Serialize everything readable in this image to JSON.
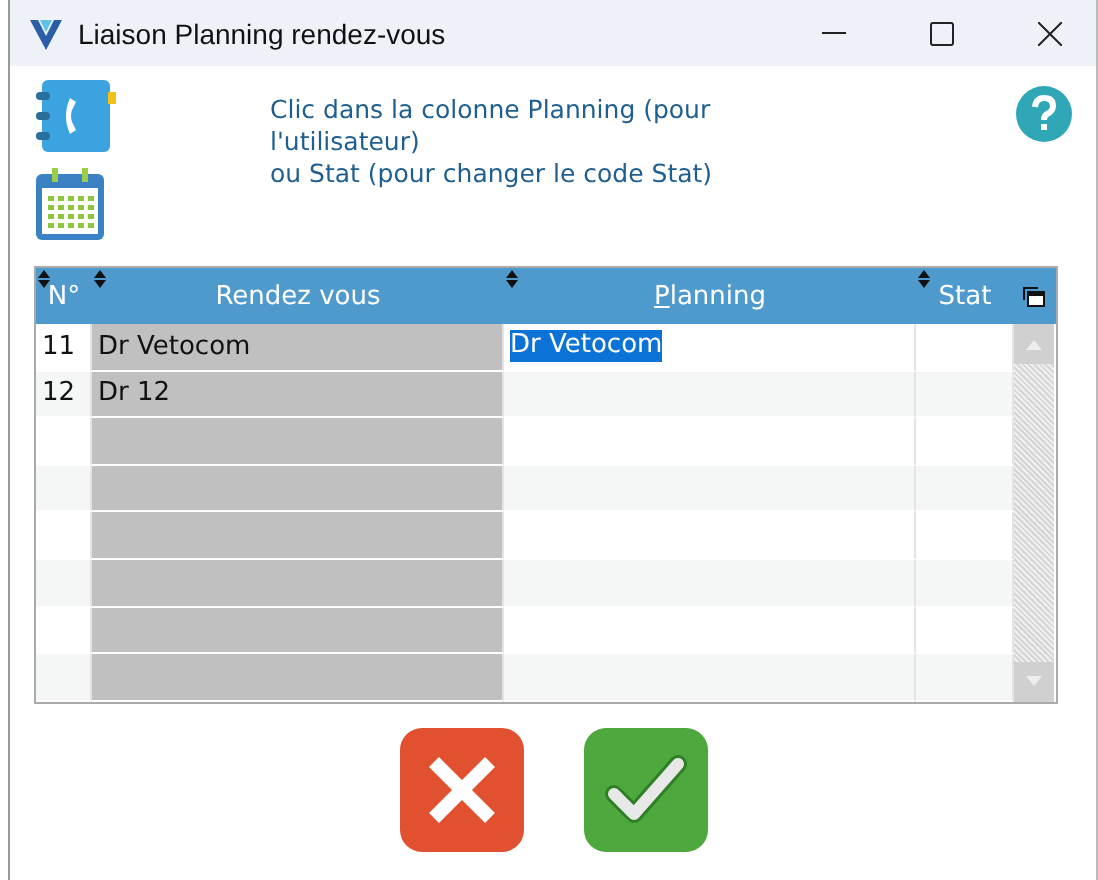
{
  "window": {
    "title": "Liaison Planning rendez-vous"
  },
  "instructions": [
    "Clic dans la colonne Planning (pour",
    "l'utilisateur)",
    "ou Stat (pour changer le code Stat)"
  ],
  "table": {
    "columns": [
      {
        "label": "N°"
      },
      {
        "label": "Rendez vous"
      },
      {
        "label": "Planning",
        "mnemonic_first": true
      },
      {
        "label": "Stat"
      }
    ],
    "rows": [
      {
        "number": "11",
        "rendez_vous": "Dr Vetocom",
        "planning": "Dr Vetocom",
        "stat": "",
        "selected": true
      },
      {
        "number": "12",
        "rendez_vous": "Dr 12",
        "planning": "",
        "stat": "",
        "selected": false
      },
      {
        "number": "",
        "rendez_vous": "",
        "planning": "",
        "stat": "",
        "selected": false
      },
      {
        "number": "",
        "rendez_vous": "",
        "planning": "",
        "stat": "",
        "selected": false
      },
      {
        "number": "",
        "rendez_vous": "",
        "planning": "",
        "stat": "",
        "selected": false
      },
      {
        "number": "",
        "rendez_vous": "",
        "planning": "",
        "stat": "",
        "selected": false
      },
      {
        "number": "",
        "rendez_vous": "",
        "planning": "",
        "stat": "",
        "selected": false
      },
      {
        "number": "",
        "rendez_vous": "",
        "planning": "",
        "stat": "",
        "selected": false
      }
    ]
  }
}
